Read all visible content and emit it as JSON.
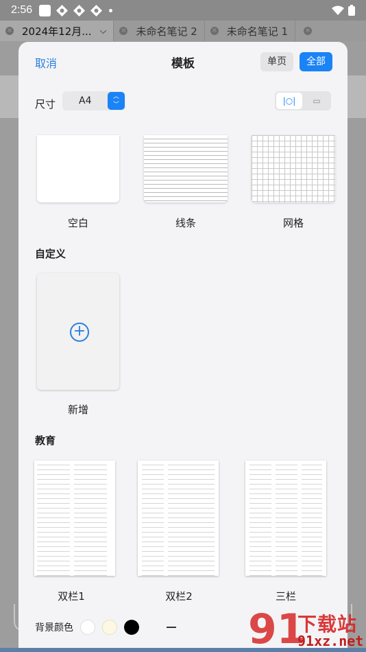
{
  "status_bar": {
    "time": "2:56"
  },
  "tabs": [
    {
      "label": "2024年12月...",
      "active": true
    },
    {
      "label": "未命名笔记 2",
      "active": false
    },
    {
      "label": "未命名笔记 1",
      "active": false
    }
  ],
  "modal": {
    "cancel_label": "取消",
    "title": "模板",
    "filter_single": "单页",
    "filter_all": "全部",
    "size_label": "尺寸",
    "size_value": "A4",
    "orientation_portrait": "|○|",
    "orientation_landscape": "▭"
  },
  "basic_templates": [
    {
      "label": "空白"
    },
    {
      "label": "线条"
    },
    {
      "label": "网格"
    }
  ],
  "custom": {
    "title": "自定义",
    "new_label": "新增"
  },
  "education": {
    "title": "教育",
    "items": [
      {
        "label": "双栏1"
      },
      {
        "label": "双栏2"
      },
      {
        "label": "三栏"
      }
    ]
  },
  "background": {
    "label": "背景颜色",
    "swatches": [
      "#ffffff",
      "#fdf8e4",
      "#000000"
    ]
  },
  "watermark": {
    "text": "下载站",
    "url": "91xz.net",
    "nine": "91"
  },
  "colors": {
    "accent": "#1a83f5",
    "link": "#2b7fe0"
  }
}
